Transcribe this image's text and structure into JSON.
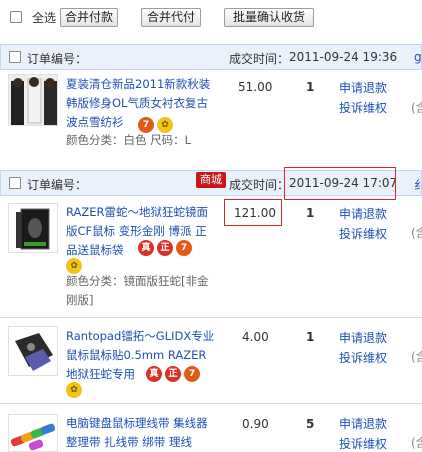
{
  "toolbar": {
    "select_all": "全选",
    "merge_pay": "合并付款",
    "merge_pay_for": "合并代付",
    "batch_confirm": "批量确认收货"
  },
  "orders": [
    {
      "order_label": "订单编号：",
      "deal_label": "成交时间：",
      "deal_time": "2011-09-24 19:36",
      "right_edge": "g",
      "items": [
        {
          "title": "夏装清仓新品2011新款秋装韩版修身OL气质女衬衣复古波点雪纺衫",
          "meta": "颜色分类：白色  尺码：L",
          "price": "51.00",
          "qty": "1",
          "action1": "申请退款",
          "action2": "投诉维权",
          "badges": [
            "7",
            "flower"
          ],
          "edge": "(含"
        }
      ]
    },
    {
      "order_label": "订单编号：",
      "mall_badge": "商城",
      "deal_label": "成交时间：",
      "deal_time": "2011-09-24 17:07",
      "right_edge": "纟",
      "items": [
        {
          "title": "RAZER雷蛇～地狱狂蛇镜面版CF鼠标 变形金刚 博派 正品送鼠标袋",
          "meta": "颜色分类：镜面版狂蛇[非金刚版]",
          "price": "121.00",
          "qty": "1",
          "action1": "申请退款",
          "action2": "投诉维权",
          "badges": [
            "真",
            "正",
            "7",
            "flower"
          ],
          "edge": "(含"
        },
        {
          "title": "Rantopad镭拓～GLIDX专业鼠标鼠标贴0.5mm RAZER地狱狂蛇专用",
          "price": "4.00",
          "qty": "1",
          "action1": "申请退款",
          "action2": "投诉维权",
          "badges": [
            "真",
            "正",
            "7",
            "flower"
          ],
          "edge": "(含"
        },
        {
          "title": "电脑键盘鼠标理线带 集线器 整理带 扎线带 绑带 理线",
          "price": "0.90",
          "qty": "5",
          "action1": "申请退款",
          "action2": "投诉维权",
          "edge": "(含"
        }
      ]
    }
  ],
  "colors": {
    "link": "#1f50b6",
    "header_bg": "#eaf1fb",
    "highlight": "#d42a2a",
    "mall": "#c8161d"
  }
}
